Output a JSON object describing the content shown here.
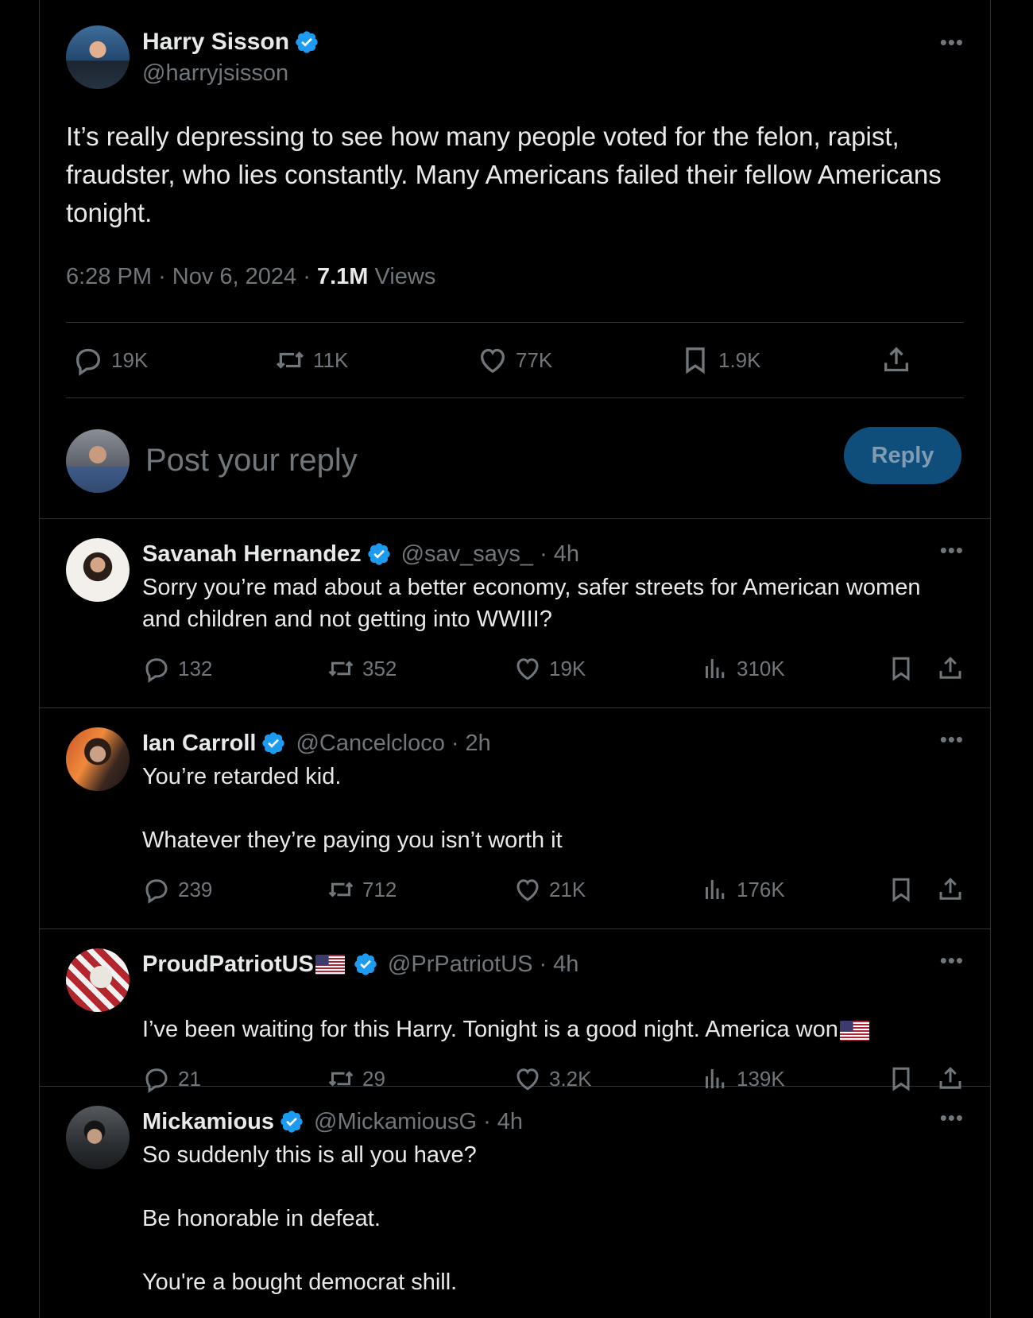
{
  "main_post": {
    "display_name": "Harry Sisson",
    "handle": "@harryjsisson",
    "text": "It’s really depressing to see how many people voted for the felon, rapist, fraudster, who lies constantly. Many Americans failed their fellow Americans tonight.",
    "time": "6:28 PM",
    "date": "Nov 6, 2024",
    "views_count": "7.1M",
    "views_label": "Views",
    "replies": "19K",
    "reposts": "11K",
    "likes": "77K",
    "bookmarks": "1.9K"
  },
  "reply_box": {
    "placeholder": "Post your reply",
    "button_label": "Reply"
  },
  "replies": [
    {
      "display_name": "Savanah Hernandez",
      "handle": "@sav_says_",
      "age": "4h",
      "text": "Sorry you’re mad about a better economy, safer streets for American women and children and not getting into WWIII?",
      "replies": "132",
      "reposts": "352",
      "likes": "19K",
      "views": "310K"
    },
    {
      "display_name": "Ian Carroll",
      "handle": "@Cancelcloco",
      "age": "2h",
      "text": "You’re retarded kid.\n\nWhatever they’re paying you isn’t worth it",
      "replies": "239",
      "reposts": "712",
      "likes": "21K",
      "views": "176K"
    },
    {
      "display_name": "ProudPatriotUS",
      "handle": "@PrPatriotUS",
      "age": "4h",
      "text": "I’ve been waiting for this Harry. Tonight is a good night. America won",
      "replies": "21",
      "reposts": "29",
      "likes": "3.2K",
      "views": "139K"
    },
    {
      "display_name": "Mickamious",
      "handle": "@MickamiousG",
      "age": "4h",
      "text": "So suddenly this is all you have?\n\nBe honorable in defeat.\n\nYou're a bought democrat shill."
    }
  ],
  "colors": {
    "background": "#000000",
    "text": "#e7e9ea",
    "secondary": "#71767b",
    "border": "#2f3336",
    "verified": "#1d9bf0"
  }
}
